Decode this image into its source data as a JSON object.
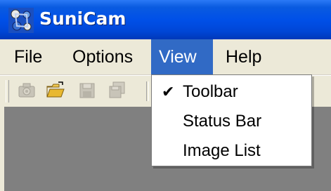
{
  "window": {
    "title": "SuniCam",
    "icon": "sunicam-app-icon"
  },
  "menubar": {
    "items": [
      {
        "label": "File",
        "active": false
      },
      {
        "label": "Options",
        "active": false
      },
      {
        "label": "View",
        "active": true
      },
      {
        "label": "Help",
        "active": false
      }
    ]
  },
  "toolbar": {
    "buttons": [
      {
        "icon": "camera-icon",
        "enabled": false
      },
      {
        "icon": "open-folder-icon",
        "enabled": true
      },
      {
        "icon": "save-icon",
        "enabled": false
      },
      {
        "icon": "save-all-icon",
        "enabled": false
      }
    ]
  },
  "view_menu": {
    "items": [
      {
        "label": "Toolbar",
        "checked": true,
        "check_glyph": "✔"
      },
      {
        "label": "Status Bar",
        "checked": false
      },
      {
        "label": "Image List",
        "checked": false
      }
    ]
  },
  "colors": {
    "titlebar": "#0050e8",
    "menu_highlight": "#316ac5",
    "client_area": "#808080",
    "chrome": "#ece9d8"
  }
}
